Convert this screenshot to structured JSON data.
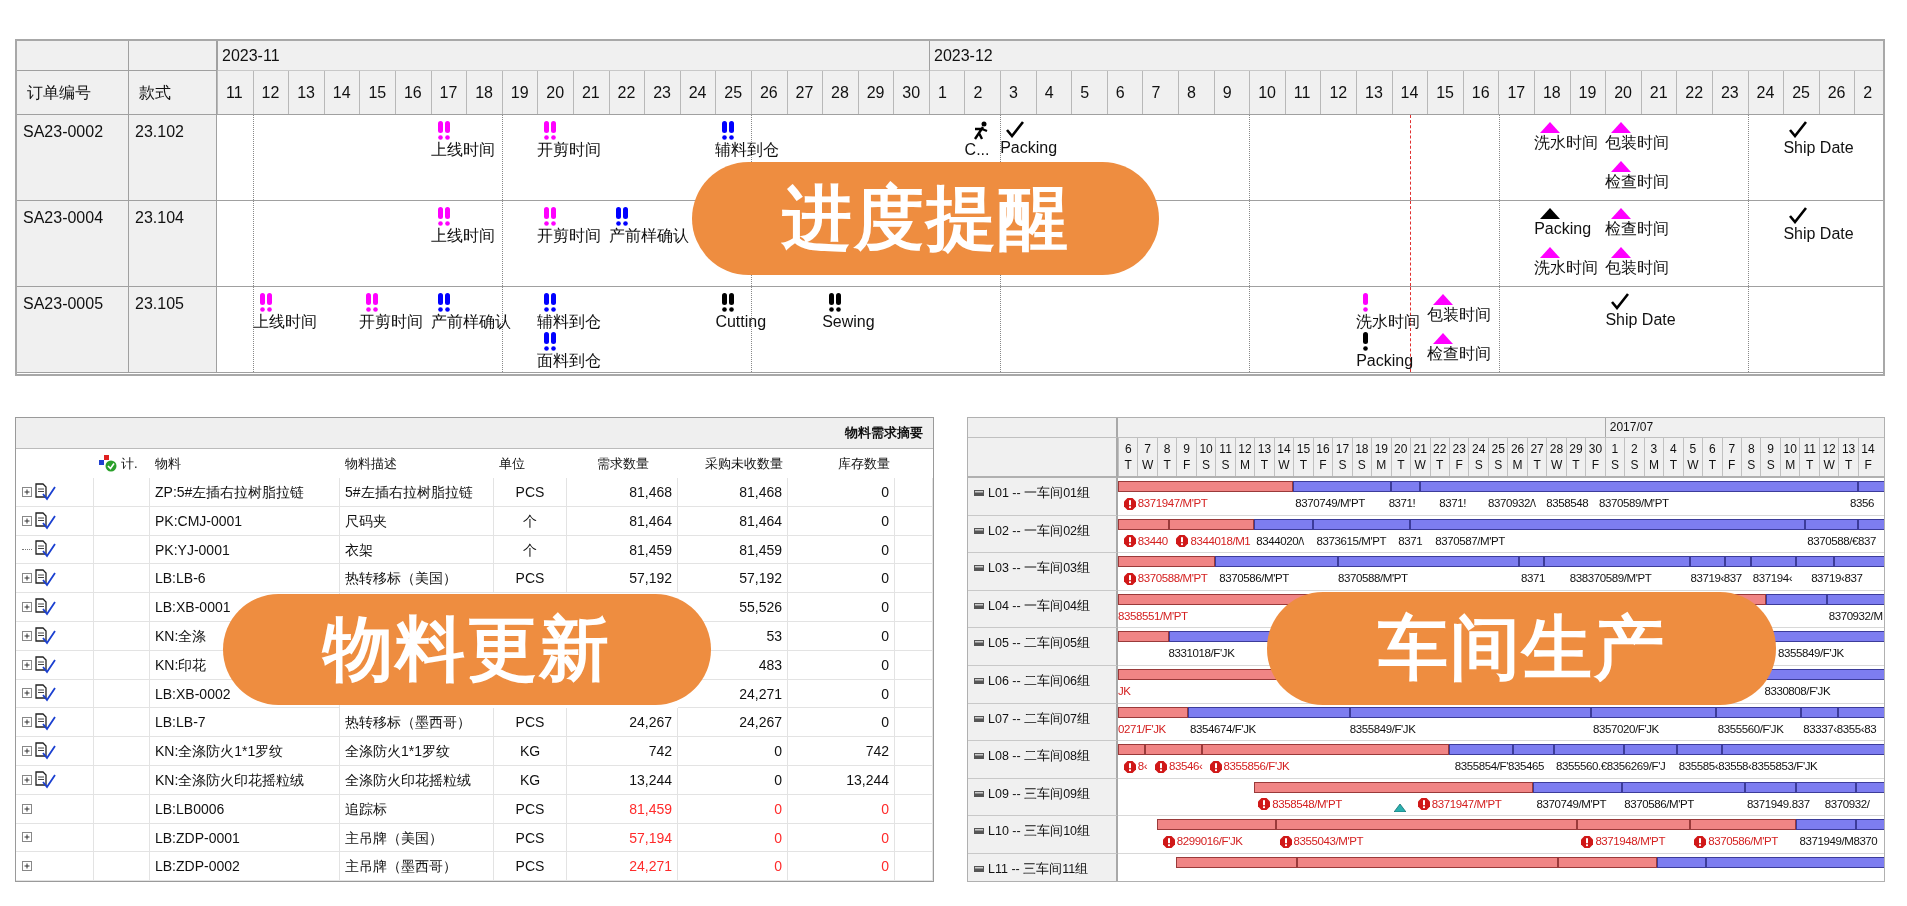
{
  "schedule": {
    "banner": "进度提醒",
    "columns": [
      "订单编号",
      "款式"
    ],
    "months": [
      {
        "label": "2023-11",
        "days": [
          "11",
          "12",
          "13",
          "14",
          "15",
          "16",
          "17",
          "18",
          "19",
          "20",
          "21",
          "22",
          "23",
          "24",
          "25",
          "26",
          "27",
          "28",
          "29",
          "30"
        ]
      },
      {
        "label": "2023-12",
        "days": [
          "1",
          "2",
          "3",
          "4",
          "5",
          "6",
          "7",
          "8",
          "9",
          "10",
          "11",
          "12",
          "13",
          "14",
          "15",
          "16",
          "17",
          "18",
          "19",
          "20",
          "21",
          "22",
          "23",
          "24",
          "25",
          "26",
          "2"
        ]
      }
    ],
    "rows": [
      {
        "order": "SA23-0002",
        "style": "23.102",
        "lanes": [
          [
            {
              "kind": "pair",
              "color": "#ff00ff",
              "label": "上线时间"
            },
            {
              "kind": "pair",
              "color": "#ff00ff",
              "label": "开剪时间"
            },
            {
              "kind": "pair",
              "color": "#0000ff",
              "label": "辅料到仓"
            },
            {
              "kind": "figure",
              "color": "#000000",
              "label": "C..."
            },
            {
              "kind": "check",
              "color": "#000000",
              "label": "Packing"
            },
            {
              "kind": "triangle",
              "color": "#ff00ff",
              "label": "洗水时间"
            },
            {
              "kind": "triangle",
              "color": "#ff00ff",
              "label": "包装时间"
            },
            {
              "kind": "check",
              "color": "#000000",
              "label": "Ship Date"
            }
          ],
          [
            {
              "kind": "triangle",
              "color": "#ff00ff",
              "label": "检查时间"
            }
          ]
        ]
      },
      {
        "order": "SA23-0004",
        "style": "23.104",
        "lanes": [
          [
            {
              "kind": "pair",
              "color": "#ff00ff",
              "label": "上线时间"
            },
            {
              "kind": "pair",
              "color": "#ff00ff",
              "label": "开剪时间"
            },
            {
              "kind": "pair",
              "color": "#0000ff",
              "label": "产前样确认"
            },
            {
              "kind": "triangle",
              "color": "#000000",
              "label": "Packing"
            },
            {
              "kind": "triangle",
              "color": "#ff00ff",
              "label": "检查时间"
            },
            {
              "kind": "check",
              "color": "#000000",
              "label": "Ship Date"
            }
          ],
          [
            {
              "kind": "triangle",
              "color": "#ff00ff",
              "label": "洗水时间"
            },
            {
              "kind": "triangle",
              "color": "#ff00ff",
              "label": "包装时间"
            }
          ]
        ]
      },
      {
        "order": "SA23-0005",
        "style": "23.105",
        "lanes": [
          [
            {
              "kind": "pair",
              "color": "#ff00ff",
              "label": "上线时间"
            },
            {
              "kind": "pair",
              "color": "#ff00ff",
              "label": "开剪时间"
            },
            {
              "kind": "pair",
              "color": "#0000ff",
              "label": "产前样确认"
            },
            {
              "kind": "pair",
              "color": "#0000ff",
              "label": "辅料到仓"
            },
            {
              "kind": "pair",
              "color": "#000000",
              "label": "Cutting"
            },
            {
              "kind": "pair",
              "color": "#000000",
              "label": "Sewing"
            },
            {
              "kind": "single",
              "color": "#ff00ff",
              "label": "洗水时间"
            },
            {
              "kind": "triangle",
              "color": "#ff00ff",
              "label": "包装时间"
            },
            {
              "kind": "check",
              "color": "#000000",
              "label": "Ship Date"
            }
          ],
          [
            {
              "kind": "pair",
              "color": "#0000ff",
              "label": "面料到仓"
            },
            {
              "kind": "single",
              "color": "#000000",
              "label": "Packing"
            },
            {
              "kind": "triangle",
              "color": "#ff00ff",
              "label": "检查时间"
            }
          ]
        ]
      }
    ]
  },
  "materials": {
    "title": "物料需求摘要",
    "banner": "物料更新",
    "columns": [
      "计.",
      "物料",
      "物料描述",
      "单位",
      "需求数量",
      "采购未收数量",
      "库存数量"
    ],
    "rows": [
      {
        "kind": "document",
        "expandable": true,
        "material": "ZP:5#左插右拉树脂拉链",
        "description": "5#左插右拉树脂拉链",
        "unit": "PCS",
        "demand": "81,468",
        "unreceived": "81,468",
        "stock": "0",
        "shortage": false
      },
      {
        "kind": "document",
        "expandable": true,
        "material": "PK:CMJ-0001",
        "description": "尺码夹",
        "unit": "个",
        "demand": "81,464",
        "unreceived": "81,464",
        "stock": "0",
        "shortage": false
      },
      {
        "kind": "document",
        "expandable": false,
        "material": "PK:YJ-0001",
        "description": "衣架",
        "unit": "个",
        "demand": "81,459",
        "unreceived": "81,459",
        "stock": "0",
        "shortage": false
      },
      {
        "kind": "document",
        "expandable": true,
        "material": "LB:LB-6",
        "description": "热转移标（美国）",
        "unit": "PCS",
        "demand": "57,192",
        "unreceived": "57,192",
        "stock": "0",
        "shortage": false
      },
      {
        "kind": "document",
        "expandable": true,
        "material": "LB:XB-0001",
        "unreceived": "55,526",
        "stock": "0",
        "shortage": false
      },
      {
        "kind": "document",
        "expandable": true,
        "material": "KN:全涤",
        "unreceived": "53",
        "stock": "0",
        "shortage": false
      },
      {
        "kind": "document",
        "expandable": true,
        "material": "KN:印花",
        "unreceived": "483",
        "stock": "0",
        "shortage": false
      },
      {
        "kind": "document",
        "expandable": true,
        "material": "LB:XB-0002",
        "unreceived": "24,271",
        "stock": "0",
        "shortage": false
      },
      {
        "kind": "document",
        "expandable": true,
        "material": "LB:LB-7",
        "description": "热转移标（墨西哥）",
        "unit": "PCS",
        "demand": "24,267",
        "unreceived": "24,267",
        "stock": "0",
        "shortage": false
      },
      {
        "kind": "document",
        "expandable": true,
        "material": "KN:全涤防火1*1罗纹",
        "description": "全涤防火1*1罗纹",
        "unit": "KG",
        "demand": "742",
        "unreceived": "0",
        "stock": "742",
        "shortage": false
      },
      {
        "kind": "document",
        "expandable": true,
        "material": "KN:全涤防火印花摇粒绒",
        "description": "全涤防火印花摇粒绒",
        "unit": "KG",
        "demand": "13,244",
        "unreceived": "0",
        "stock": "13,244",
        "shortage": false
      },
      {
        "kind": "plain",
        "expandable": true,
        "material": "LB:LB0006",
        "description": "追踪标",
        "unit": "PCS",
        "demand": "81,459",
        "unreceived": "0",
        "stock": "0",
        "shortage": true
      },
      {
        "kind": "plain",
        "expandable": true,
        "material": "LB:ZDP-0001",
        "description": "主吊牌（美国）",
        "unit": "PCS",
        "demand": "57,194",
        "unreceived": "0",
        "stock": "0",
        "shortage": true
      },
      {
        "kind": "plain",
        "expandable": true,
        "material": "LB:ZDP-0002",
        "description": "主吊牌（墨西哥）",
        "unit": "PCS",
        "demand": "24,271",
        "unreceived": "0",
        "stock": "0",
        "shortage": true
      }
    ]
  },
  "production": {
    "banner": "车间生产",
    "months": [
      {
        "days": [
          {
            "day": "6",
            "weekday": "T"
          },
          {
            "day": "7",
            "weekday": "W"
          },
          {
            "day": "8",
            "weekday": "T"
          },
          {
            "day": "9",
            "weekday": "F"
          },
          {
            "day": "10",
            "weekday": "S"
          },
          {
            "day": "11",
            "weekday": "S"
          },
          {
            "day": "12",
            "weekday": "M"
          },
          {
            "day": "13",
            "weekday": "T"
          },
          {
            "day": "14",
            "weekday": "W"
          },
          {
            "day": "15",
            "weekday": "T"
          },
          {
            "day": "16",
            "weekday": "F"
          },
          {
            "day": "17",
            "weekday": "S"
          },
          {
            "day": "18",
            "weekday": "S"
          },
          {
            "day": "19",
            "weekday": "M"
          },
          {
            "day": "20",
            "weekday": "T"
          },
          {
            "day": "21",
            "weekday": "W"
          },
          {
            "day": "22",
            "weekday": "T"
          },
          {
            "day": "23",
            "weekday": "F"
          },
          {
            "day": "24",
            "weekday": "S"
          },
          {
            "day": "25",
            "weekday": "S"
          },
          {
            "day": "26",
            "weekday": "M"
          },
          {
            "day": "27",
            "weekday": "T"
          },
          {
            "day": "28",
            "weekday": "W"
          },
          {
            "day": "29",
            "weekday": "T"
          },
          {
            "day": "30",
            "weekday": "F"
          }
        ]
      },
      {
        "label": "2017/07",
        "days": [
          {
            "day": "1",
            "weekday": "S"
          },
          {
            "day": "2",
            "weekday": "S"
          },
          {
            "day": "3",
            "weekday": "M"
          },
          {
            "day": "4",
            "weekday": "T"
          },
          {
            "day": "5",
            "weekday": "W"
          },
          {
            "day": "6",
            "weekday": "T"
          },
          {
            "day": "7",
            "weekday": "F"
          },
          {
            "day": "8",
            "weekday": "S"
          },
          {
            "day": "9",
            "weekday": "S"
          },
          {
            "day": "10",
            "weekday": "M"
          },
          {
            "day": "11",
            "weekday": "T"
          },
          {
            "day": "12",
            "weekday": "W"
          },
          {
            "day": "13",
            "weekday": "T"
          },
          {
            "day": "14",
            "weekday": "F"
          }
        ]
      }
    ],
    "rows": [
      {
        "line": "L01 -- 一车间01组",
        "segments": [
          {
            "overdue": true
          },
          {
            "overdue": false
          },
          {
            "overdue": false
          },
          {
            "overdue": false
          },
          {
            "overdue": false
          }
        ],
        "labels": [
          {
            "text": "8371947/M'PT",
            "overdue": true,
            "warning": true
          },
          {
            "text": "8370749/M'PT",
            "overdue": false,
            "warning": false
          },
          {
            "text": "8371!",
            "overdue": false,
            "warning": false
          },
          {
            "text": "8371!",
            "overdue": false,
            "warning": false
          },
          {
            "text": "8370932/\\",
            "overdue": false,
            "warning": false
          },
          {
            "text": "8358548",
            "overdue": false,
            "warning": false
          },
          {
            "text": "8370589/M'PT",
            "overdue": false,
            "warning": false
          },
          {
            "text": "8356",
            "overdue": false,
            "warning": false
          }
        ]
      },
      {
        "line": "L02 -- 一车间02组",
        "segments": [
          {
            "overdue": true
          },
          {
            "overdue": true
          },
          {
            "overdue": false
          },
          {
            "overdue": false
          },
          {
            "overdue": false
          },
          {
            "overdue": false
          },
          {
            "overdue": false
          }
        ],
        "labels": [
          {
            "text": "83440",
            "overdue": true,
            "warning": true
          },
          {
            "text": "8344018/M1",
            "overdue": true,
            "warning": true
          },
          {
            "text": "8344020/\\",
            "overdue": false,
            "warning": false
          },
          {
            "text": "8373615/M'PT",
            "overdue": false,
            "warning": false
          },
          {
            "text": "8371",
            "overdue": false,
            "warning": false
          },
          {
            "text": "8370587/M'PT",
            "overdue": false,
            "warning": false
          },
          {
            "text": "8370588/€837",
            "overdue": false,
            "warning": false
          }
        ]
      },
      {
        "line": "L03 -- 一车间03组",
        "segments": [
          {
            "overdue": true
          },
          {
            "overdue": false
          },
          {
            "overdue": false
          },
          {
            "overdue": false
          },
          {
            "overdue": false
          },
          {
            "overdue": false
          },
          {
            "overdue": false
          },
          {
            "overdue": false
          },
          {
            "overdue": false
          },
          {
            "overdue": false
          }
        ],
        "labels": [
          {
            "text": "8370588/M'PT",
            "overdue": true,
            "warning": true
          },
          {
            "text": "8370586/M'PT",
            "overdue": false,
            "warning": false
          },
          {
            "text": "8370588/M'PT",
            "overdue": false,
            "warning": false
          },
          {
            "text": "8371",
            "overdue": false,
            "warning": false
          },
          {
            "text": "838370589/M'PT",
            "overdue": false,
            "warning": false
          },
          {
            "text": "83719‹837",
            "overdue": false,
            "warning": false
          },
          {
            "text": "837194‹",
            "overdue": false,
            "warning": false
          },
          {
            "text": "83719‹837",
            "overdue": false,
            "warning": false
          }
        ]
      },
      {
        "line": "L04 -- 一车间04组",
        "segments": [
          {
            "overdue": true
          },
          {
            "overdue": false
          },
          {
            "overdue": false
          }
        ],
        "labels": [
          {
            "text": "8358551/M'PT",
            "overdue": true,
            "warning": false
          },
          {
            "text": "8370932/M",
            "overdue": false,
            "warning": false
          }
        ]
      },
      {
        "line": "L05 -- 二车间05组",
        "segments": [
          {
            "overdue": true
          },
          {
            "overdue": false
          },
          {
            "overdue": false
          }
        ],
        "labels": [
          {
            "text": "8331018/F'JK",
            "overdue": false,
            "warning": false
          },
          {
            "text": "8355849/F'JK",
            "overdue": false,
            "warning": false
          }
        ]
      },
      {
        "line": "L06 -- 二车间06组",
        "segments": [
          {
            "overdue": true
          },
          {
            "overdue": false
          }
        ],
        "labels": [
          {
            "text": "JK",
            "overdue": true,
            "warning": false
          },
          {
            "text": "8330808/F'JK",
            "overdue": false,
            "warning": false
          }
        ]
      },
      {
        "line": "L07 -- 二车间07组",
        "segments": [
          {
            "overdue": true
          },
          {
            "overdue": false
          },
          {
            "overdue": false
          },
          {
            "overdue": false
          },
          {
            "overdue": false
          },
          {
            "overdue": false
          },
          {
            "overdue": false
          }
        ],
        "labels": [
          {
            "text": "0271/F'JK",
            "overdue": true,
            "warning": false
          },
          {
            "text": "8354674/F'JK",
            "overdue": false,
            "warning": false
          },
          {
            "text": "8355849/F'JK",
            "overdue": false,
            "warning": false
          },
          {
            "text": "8357020/F'JK",
            "overdue": false,
            "warning": false
          },
          {
            "text": "8355560/F'JK",
            "overdue": false,
            "warning": false
          },
          {
            "text": "83337‹8355‹83",
            "overdue": false,
            "warning": false
          }
        ]
      },
      {
        "line": "L08 -- 二车间08组",
        "segments": [
          {
            "overdue": true
          },
          {
            "overdue": true
          },
          {
            "overdue": true
          },
          {
            "overdue": false
          },
          {
            "overdue": false
          },
          {
            "overdue": false
          },
          {
            "overdue": false
          },
          {
            "overdue": false
          },
          {
            "overdue": false
          }
        ],
        "labels": [
          {
            "text": "8‹",
            "overdue": true,
            "warning": true
          },
          {
            "text": "83546‹",
            "overdue": true,
            "warning": true
          },
          {
            "text": "8355856/F'JK",
            "overdue": true,
            "warning": true
          },
          {
            "text": "8355854/F'835465",
            "overdue": false,
            "warning": false
          },
          {
            "text": "8355560.€8356269/F'J",
            "overdue": false,
            "warning": false
          },
          {
            "text": "835585‹83558‹8355853/F'JK",
            "overdue": false,
            "warning": false
          }
        ]
      },
      {
        "line": "L09 -- 三车间09组",
        "segments": [
          {
            "overdue": true
          },
          {
            "overdue": false
          },
          {
            "overdue": false
          },
          {
            "overdue": false
          },
          {
            "overdue": false
          },
          {
            "overdue": false
          }
        ],
        "milestones": [
          {
            "kind": "triangle"
          }
        ],
        "labels": [
          {
            "text": "8358548/M'PT",
            "overdue": true,
            "warning": true
          },
          {
            "text": "8371947/M'PT",
            "overdue": true,
            "warning": true
          },
          {
            "text": "8370749/M'PT",
            "overdue": false,
            "warning": false
          },
          {
            "text": "8370586/M'PT",
            "overdue": false,
            "warning": false
          },
          {
            "text": "8371949.837",
            "overdue": false,
            "warning": false
          },
          {
            "text": "8370932/",
            "overdue": false,
            "warning": false
          }
        ]
      },
      {
        "line": "L10 -- 三车间10组",
        "segments": [
          {
            "overdue": true
          },
          {
            "overdue": true
          },
          {
            "overdue": true
          },
          {
            "overdue": true
          },
          {
            "overdue": false
          },
          {
            "overdue": false
          }
        ],
        "labels": [
          {
            "text": "8299016/F'JK",
            "overdue": true,
            "warning": true
          },
          {
            "text": "8355043/M'PT",
            "overdue": true,
            "warning": true
          },
          {
            "text": "8371948/M'PT",
            "overdue": true,
            "warning": true
          },
          {
            "text": "8370586/M'PT",
            "overdue": true,
            "warning": true
          },
          {
            "text": "8371949/M8370",
            "overdue": false,
            "warning": false
          }
        ]
      },
      {
        "line": "L11 -- 三车间11组",
        "segments": [
          {
            "overdue": true
          },
          {
            "overdue": true
          },
          {
            "overdue": true
          },
          {
            "overdue": false
          },
          {
            "overdue": false
          }
        ]
      }
    ]
  }
}
